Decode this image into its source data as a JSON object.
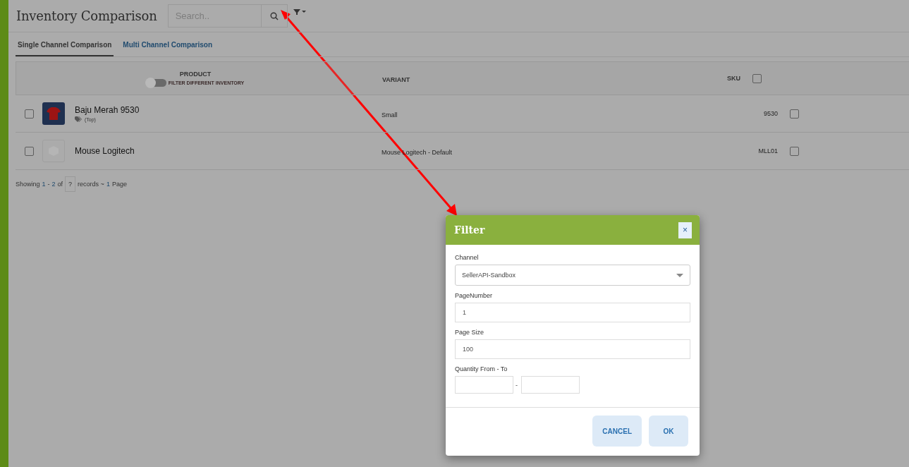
{
  "page": {
    "title": "Inventory Comparison",
    "search": {
      "placeholder": "Search.."
    }
  },
  "tabs": [
    {
      "label": "Single Channel Comparison",
      "selected": true
    },
    {
      "label": "Multi Channel Comparison",
      "selected": false
    }
  ],
  "table": {
    "columns": {
      "product": "PRODUCT",
      "toggle": {
        "label": "FILTER DIFFERENT INVENTORY",
        "on": false
      },
      "variant": "VARIANT",
      "sku": "SKU",
      "select_all": false
    },
    "rows": [
      {
        "name": "Baju Merah 9530",
        "tag": "(Top)",
        "kind": "photo",
        "variant": "Small",
        "sku": "9530",
        "checked": false,
        "sku_checked": false
      },
      {
        "name": "Mouse Logitech",
        "kind": "placeholder",
        "variant": "Mouse Logitech - Default",
        "sku": "MLL01",
        "checked": false,
        "sku_checked": false
      }
    ]
  },
  "footer": {
    "showing": "Showing",
    "from": "1",
    "sep": "-",
    "to": "2",
    "of": "of",
    "total": "?",
    "records": "records ~",
    "pages": "1",
    "page_word": "Page"
  },
  "dialog": {
    "title": "Filter",
    "close": "×",
    "fields": [
      {
        "kind": "select",
        "label": "Channel",
        "value": "SellerAPI-Sandbox"
      },
      {
        "kind": "text",
        "label": "PageNumber",
        "value": "1"
      },
      {
        "kind": "text",
        "label": "Page Size",
        "value": "100"
      },
      {
        "kind": "range",
        "label": "Quantity From - To",
        "separator": "-"
      }
    ],
    "buttons": [
      "CANCEL",
      "OK"
    ]
  }
}
